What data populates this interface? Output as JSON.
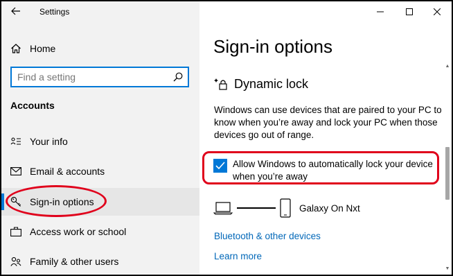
{
  "window": {
    "title": "Settings"
  },
  "sidebar": {
    "home_label": "Home",
    "search_placeholder": "Find a setting",
    "section_heading": "Accounts",
    "items": [
      {
        "label": "Your info",
        "icon": "person-card-icon"
      },
      {
        "label": "Email & accounts",
        "icon": "envelope-icon"
      },
      {
        "label": "Sign-in options",
        "icon": "key-icon",
        "active": true
      },
      {
        "label": "Access work or school",
        "icon": "briefcase-icon"
      },
      {
        "label": "Family & other users",
        "icon": "people-icon"
      }
    ]
  },
  "content": {
    "page_title": "Sign-in options",
    "dynamic_lock_heading": "Dynamic lock",
    "description": "Windows can use devices that are paired to your PC to know when you’re away and lock your PC when those devices go out of range.",
    "checkbox_label": "Allow Windows to automatically lock your device when you’re away",
    "checkbox_checked": true,
    "device_name": "Galaxy On Nxt",
    "link_bluetooth": "Bluetooth & other devices",
    "link_learn_more": "Learn more"
  },
  "colors": {
    "accent": "#0078d7",
    "link": "#0067b8",
    "highlight": "#e0001b",
    "sidebar_bg": "#f2f2f2"
  }
}
